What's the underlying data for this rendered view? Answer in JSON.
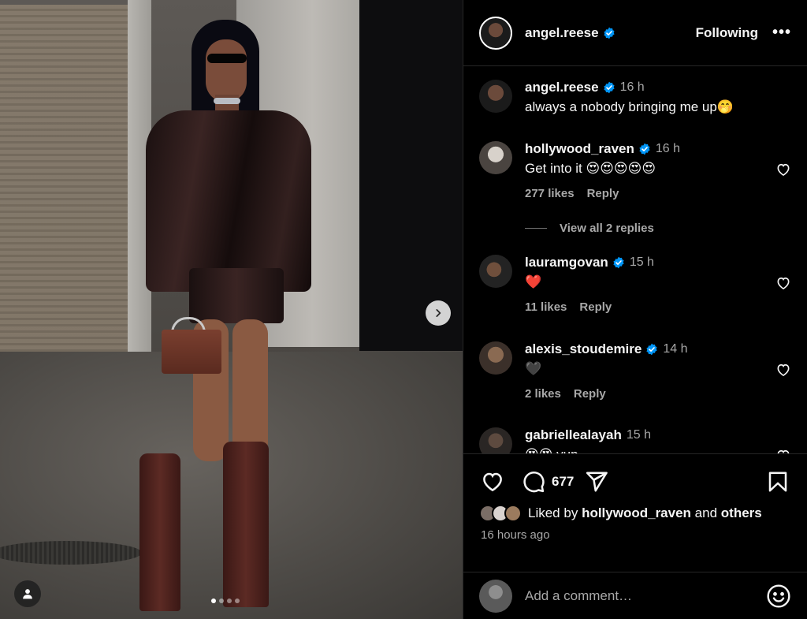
{
  "post": {
    "author": "angel.reese",
    "follow_label": "Following",
    "more_label": "•••",
    "image_index": 1,
    "image_count": 4
  },
  "comments": [
    {
      "user": "angel.reese",
      "time": "16 h",
      "text": "always a nobody bringing me up🤭",
      "likes": "",
      "reply": ""
    },
    {
      "user": "hollywood_raven",
      "time": "16 h",
      "text": "Get into it 😍😍😍😍😍",
      "likes": "277 likes",
      "reply": "Reply"
    },
    {
      "user": "lauramgovan",
      "time": "15 h",
      "text": "❤️",
      "likes": "11 likes",
      "reply": "Reply"
    },
    {
      "user": "alexis_stoudemire",
      "time": "14 h",
      "text": "🖤",
      "likes": "2 likes",
      "reply": "Reply"
    },
    {
      "user": "gabriellealayah",
      "time": "15 h",
      "text": "😍😍 yup",
      "likes": "",
      "reply": ""
    }
  ],
  "view_replies": "View all 2 replies",
  "actions": {
    "comment_count": "677"
  },
  "liked": {
    "prefix": "Liked by",
    "user": "hollywood_raven",
    "and": "and",
    "others": "others"
  },
  "timestamp": "16 hours ago",
  "add_comment": {
    "placeholder": "Add a comment…"
  },
  "colors": {
    "verified": "#0095f6",
    "panel_bg": "#000000",
    "muted": "#a8a8a8"
  }
}
